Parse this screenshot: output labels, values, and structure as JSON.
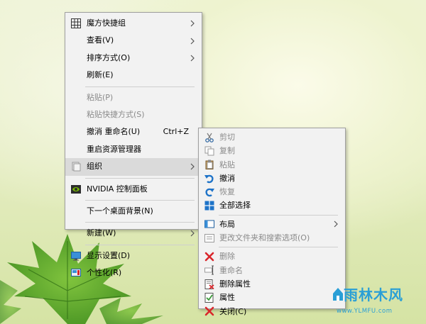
{
  "main_menu": {
    "items": [
      {
        "label": "魔方快捷组",
        "submenu": true
      },
      {
        "label": "查看(V)",
        "submenu": true
      },
      {
        "label": "排序方式(O)",
        "submenu": true
      },
      {
        "label": "刷新(E)"
      },
      {
        "label": "粘贴(P)",
        "disabled": true
      },
      {
        "label": "粘贴快捷方式(S)",
        "disabled": true
      },
      {
        "label": "撤消 重命名(U)",
        "shortcut": "Ctrl+Z"
      },
      {
        "label": "重启资源管理器"
      },
      {
        "label": "组织",
        "submenu": true,
        "highlighted": true
      },
      {
        "label": "NVIDIA 控制面板"
      },
      {
        "label": "下一个桌面背景(N)"
      },
      {
        "label": "新建(W)",
        "submenu": true
      },
      {
        "label": "显示设置(D)"
      },
      {
        "label": "个性化(R)"
      }
    ]
  },
  "sub_menu": {
    "items": [
      {
        "label": "剪切",
        "disabled": true,
        "icon": "scissors-icon"
      },
      {
        "label": "复制",
        "disabled": true,
        "icon": "copy-icon"
      },
      {
        "label": "粘贴",
        "disabled": true,
        "icon": "paste-icon"
      },
      {
        "label": "撤消",
        "icon": "undo-icon"
      },
      {
        "label": "恢复",
        "disabled": true,
        "icon": "redo-icon"
      },
      {
        "label": "全部选择",
        "icon": "select-all-icon"
      },
      {
        "label": "布局",
        "submenu": true,
        "icon": "layout-icon"
      },
      {
        "label": "更改文件夹和搜索选项(O)",
        "disabled": true,
        "icon": "folder-options-icon"
      },
      {
        "label": "删除",
        "disabled": true,
        "icon": "delete-icon"
      },
      {
        "label": "重命名",
        "disabled": true,
        "icon": "rename-icon"
      },
      {
        "label": "删除属性",
        "icon": "remove-properties-icon"
      },
      {
        "label": "属性",
        "icon": "properties-icon"
      },
      {
        "label": "关闭(C)",
        "icon": "close-icon"
      }
    ]
  },
  "watermark": {
    "title": "雨林木风",
    "url": "www.YLMFU.com"
  },
  "colors": {
    "menu_bg": "#f2f2f2",
    "highlight_bg": "#dadada",
    "disabled_text": "#8a8a8a",
    "watermark": "#2a9fd6",
    "delete_red": "#d9262b",
    "icon_blue": "#1e73c8"
  }
}
